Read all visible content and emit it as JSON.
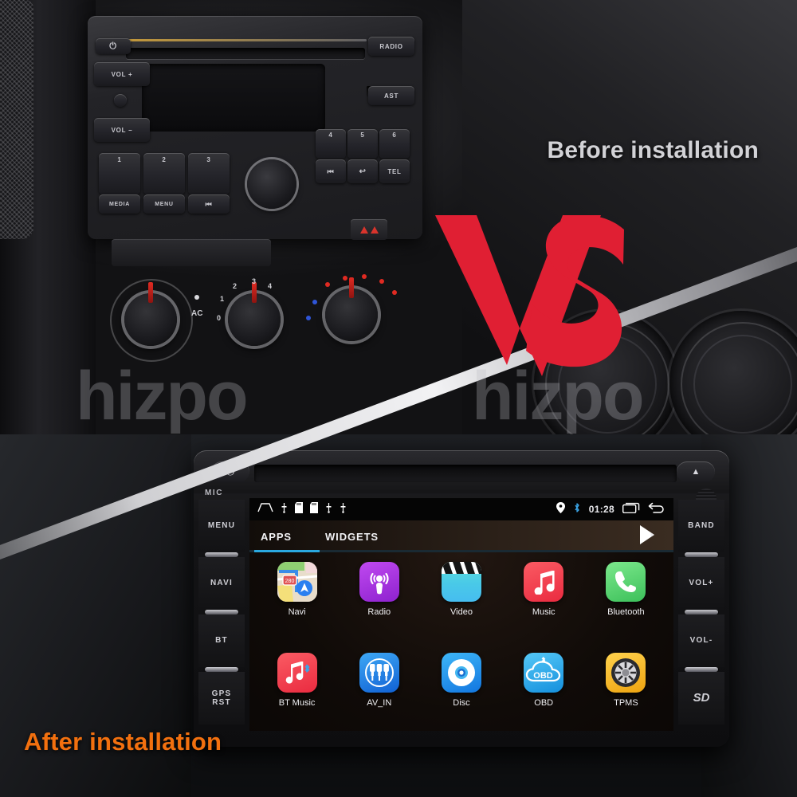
{
  "overlay": {
    "before_label": "Before installation",
    "after_label": "After installation",
    "vs_label": "VS",
    "watermark": "hizpo",
    "accent_orange": "#f2700f",
    "vs_red": "#e01f33",
    "tab_accent": "#2aa8e0"
  },
  "factory_radio": {
    "power_icon": "power-icon",
    "buttons": [
      {
        "label": "VOL +"
      },
      {
        "label": "VOL −"
      },
      {
        "label": "RADIO"
      },
      {
        "label": "AST"
      },
      {
        "label": "TEL"
      },
      {
        "label": "1"
      },
      {
        "label": "2"
      },
      {
        "label": "3"
      },
      {
        "label": "4"
      },
      {
        "label": "5"
      },
      {
        "label": "6"
      },
      {
        "label": "MEDIA"
      },
      {
        "label": "MENU"
      }
    ]
  },
  "climate": {
    "ac_label": "AC",
    "fan_positions": [
      "0",
      "1",
      "2",
      "3",
      "4"
    ]
  },
  "head_unit": {
    "mic_label": "MIC",
    "power_icon": "power-icon",
    "eject_icon": "eject-icon",
    "left_buttons": [
      {
        "label": "MENU",
        "name": "menu"
      },
      {
        "label": "NAVI",
        "name": "navi"
      },
      {
        "label": "BT",
        "name": "bt"
      },
      {
        "label": "GPS\nRST",
        "name": "gps-rst"
      }
    ],
    "right_buttons": [
      {
        "label": "BAND",
        "name": "band"
      },
      {
        "label": "VOL+",
        "name": "vol-up"
      },
      {
        "label": "VOL-",
        "name": "vol-down"
      },
      {
        "label": "SD",
        "name": "sd"
      }
    ]
  },
  "screen": {
    "statusbar": {
      "time": "01:28",
      "left_icons": [
        "home-icon",
        "usb-icon",
        "sd-card-icon",
        "sd-card-icon",
        "usb-icon",
        "usb-icon"
      ],
      "right_icons": [
        "location-pin-icon",
        "bluetooth-icon",
        "recents-icon",
        "back-icon"
      ]
    },
    "tabs": [
      {
        "label": "APPS",
        "active": true
      },
      {
        "label": "WIDGETS",
        "active": false
      }
    ],
    "playstore_icon": "play-store-icon",
    "apps": [
      {
        "label": "Navi",
        "icon": "map-icon",
        "color": "#d9cfc0"
      },
      {
        "label": "Radio",
        "icon": "podcast-icon",
        "color": "#a339e0"
      },
      {
        "label": "Video",
        "icon": "clapperboard-icon",
        "color": "#4ad4d4"
      },
      {
        "label": "Music",
        "icon": "music-note-icon",
        "color": "#f2414f"
      },
      {
        "label": "Bluetooth",
        "icon": "phone-icon",
        "color": "#4ed06a"
      },
      {
        "label": "BT Music",
        "icon": "bt-music-icon",
        "color": "#f2414f"
      },
      {
        "label": "AV_IN",
        "icon": "rca-plugs-icon",
        "color": "#1e86e8"
      },
      {
        "label": "Disc",
        "icon": "disc-icon",
        "color": "#1e9ff0"
      },
      {
        "label": "OBD",
        "icon": "obd-cloud-icon",
        "color": "#2bb4ef"
      },
      {
        "label": "TPMS",
        "icon": "tire-icon",
        "color": "#f5b61a"
      }
    ]
  }
}
